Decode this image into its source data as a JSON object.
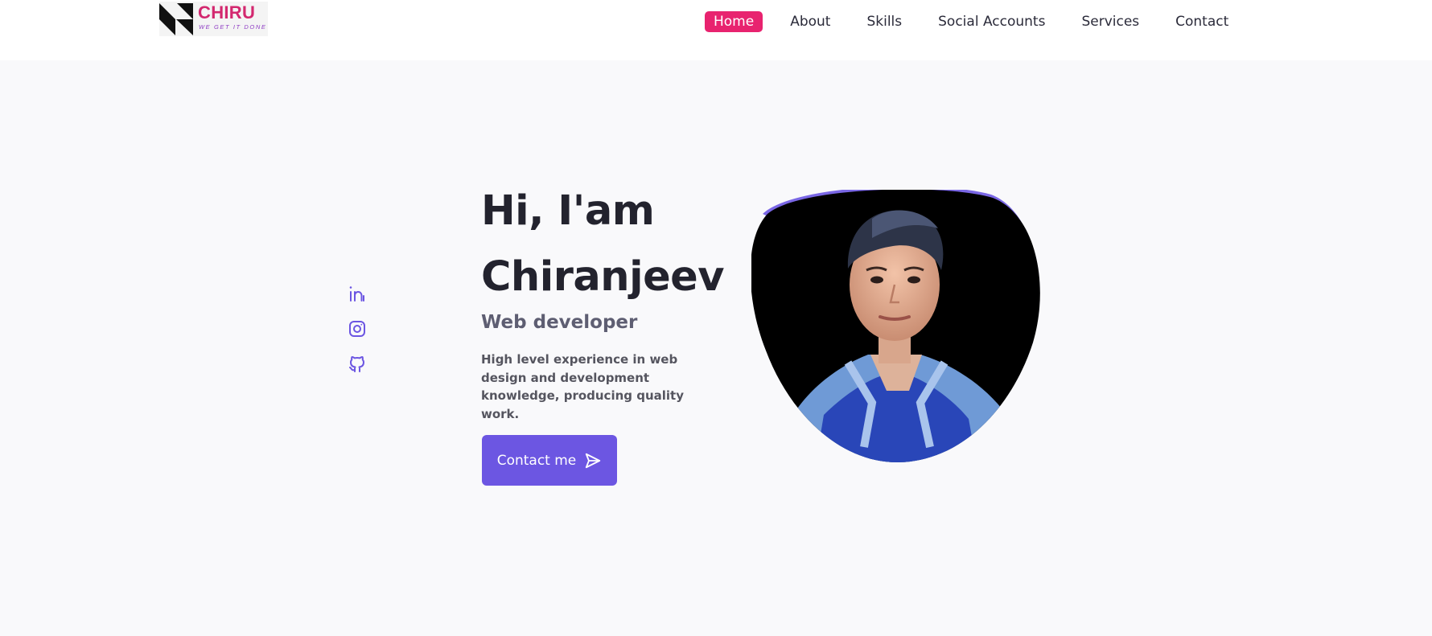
{
  "logo": {
    "brand": "CHIRU",
    "tagline": "WE GET IT DONE"
  },
  "nav": {
    "items": [
      {
        "label": "Home",
        "active": true
      },
      {
        "label": "About"
      },
      {
        "label": "Skills"
      },
      {
        "label": "Social Accounts"
      },
      {
        "label": "Services"
      },
      {
        "label": "Contact"
      }
    ]
  },
  "social": {
    "icons": [
      "linkedin-icon",
      "instagram-icon",
      "github-icon"
    ]
  },
  "hero": {
    "greeting": "Hi, I'am",
    "name": "Chiranjeev",
    "role": "Web developer",
    "description": "High level experience in web design and development knowledge, producing quality work.",
    "cta_label": "Contact me"
  },
  "colors": {
    "accent": "#6c56e2",
    "nav_active": "#e8236f",
    "brand": "#d3286f",
    "background": "#f9f9fb"
  }
}
